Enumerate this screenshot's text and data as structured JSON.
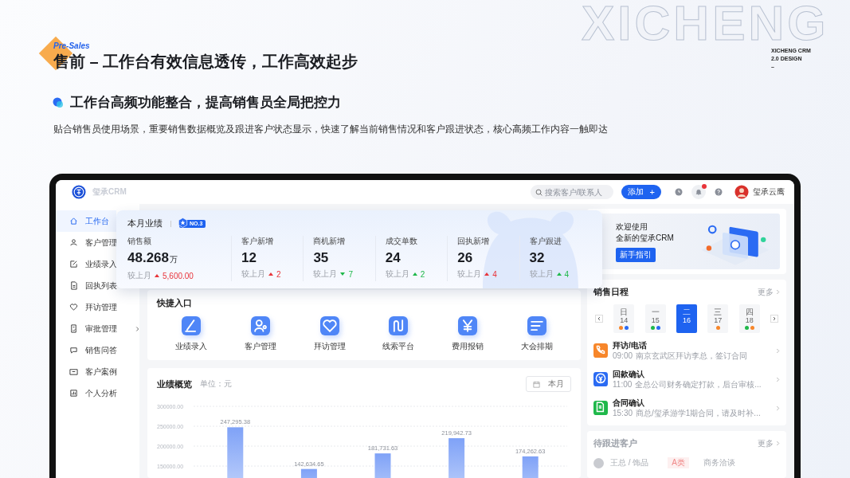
{
  "slide": {
    "tag": "Pre-Sales",
    "title": "售前 – 工作台有效信息透传，工作高效起步",
    "backdrop": "XICHENG",
    "brand_lines": [
      "XICHENG CRM",
      "2.0 DESIGN",
      "–"
    ],
    "heading": "工作台高频功能整合，提高销售员全局把控力",
    "description": "贴合销售员使用场景，重要销售数据概览及跟进客户状态显示，快速了解当前销售情况和客户跟进状态，核心高频工作内容一触即达"
  },
  "app": {
    "logo_text": "玺承CRM",
    "search": {
      "placeholder": "搜索客户/联系人"
    },
    "add_button": "添加",
    "add_icon": "+",
    "unread": true,
    "user_name": "玺承云鹰"
  },
  "sidebar": {
    "items": [
      {
        "label": "工作台",
        "selected": true,
        "expandable": false
      },
      {
        "label": "客户管理",
        "selected": false,
        "expandable": false
      },
      {
        "label": "业绩录入",
        "selected": false,
        "expandable": false
      },
      {
        "label": "回执列表",
        "selected": false,
        "expandable": false
      },
      {
        "label": "拜访管理",
        "selected": false,
        "expandable": false
      },
      {
        "label": "审批管理",
        "selected": false,
        "expandable": true
      },
      {
        "label": "销售问答",
        "selected": false,
        "expandable": false
      },
      {
        "label": "客户案例",
        "selected": false,
        "expandable": false
      },
      {
        "label": "个人分析",
        "selected": false,
        "expandable": false
      }
    ]
  },
  "performance": {
    "title": "本月业绩",
    "rank": "NO.3",
    "stats": [
      {
        "label": "销售额",
        "value": "48.268",
        "unit": "万",
        "compare_label": "较上月",
        "rising": true,
        "change": "5,600.00",
        "color": "#e8343a"
      },
      {
        "label": "客户新增",
        "value": "12",
        "compare_label": "较上月",
        "rising": true,
        "change": "2",
        "color": "#e8343a"
      },
      {
        "label": "商机新增",
        "value": "35",
        "compare_label": "较上月",
        "rising": false,
        "change": "7",
        "color": "#1fb84a"
      },
      {
        "label": "成交单数",
        "value": "24",
        "compare_label": "较上月",
        "rising": true,
        "change": "2",
        "color": "#1fb84a"
      },
      {
        "label": "回执新增",
        "value": "26",
        "compare_label": "较上月",
        "rising": true,
        "change": "4",
        "color": "#e8343a"
      },
      {
        "label": "客户跟进",
        "value": "32",
        "compare_label": "较上月",
        "rising": true,
        "change": "4",
        "color": "#1fb84a"
      }
    ]
  },
  "quick_entry": {
    "title": "快捷入口",
    "items": [
      "业绩录入",
      "客户管理",
      "拜访管理",
      "线索平台",
      "费用报销",
      "大会排期"
    ]
  },
  "overview": {
    "title": "业绩概览",
    "unit_label": "单位：元",
    "period": "本月",
    "chart_data": {
      "type": "bar",
      "values": [
        247295.38,
        142634.65,
        181731.63,
        219942.73,
        174262.63
      ],
      "value_labels": [
        "247,295.38",
        "142,634.65",
        "181,731.63",
        "219,942.73",
        "174,262.63"
      ],
      "ylim": [
        0,
        300000
      ],
      "grid": true,
      "yticks": [
        {
          "value": 300000,
          "label": "300000.00"
        },
        {
          "value": 250000,
          "label": "250000.00"
        },
        {
          "value": 200000,
          "label": "200000.00"
        },
        {
          "value": 150000,
          "label": "150000.00"
        }
      ]
    }
  },
  "welcome": {
    "lines": [
      "欢迎使用",
      "全新的玺承CRM"
    ],
    "button": "新手指引"
  },
  "schedule": {
    "title": "销售日程",
    "more": "更多",
    "days": [
      {
        "weekday": "日",
        "date": "14",
        "selected": false,
        "dots": [
          {
            "color": "#f7862a"
          },
          {
            "color": "#2b6bf3"
          }
        ]
      },
      {
        "weekday": "一",
        "date": "15",
        "selected": false,
        "dots": [
          {
            "color": "#1fb84a"
          },
          {
            "color": "#2b6bf3"
          }
        ]
      },
      {
        "weekday": "二",
        "date": "16",
        "selected": true
      },
      {
        "weekday": "三",
        "date": "17",
        "selected": false,
        "dots": [
          {
            "color": "#f7862a"
          }
        ]
      },
      {
        "weekday": "四",
        "date": "18",
        "selected": false,
        "dots": [
          {
            "color": "#1fb84a"
          },
          {
            "color": "#f7862a"
          }
        ]
      }
    ],
    "events": [
      {
        "title": "拜访/电话",
        "time": "09:00",
        "detail": "南京玄武区拜访李总，签订合同",
        "color": "#f7862a"
      },
      {
        "title": "回款确认",
        "time": "11:00",
        "detail": "全总公司财务确定打款，后台审核...",
        "color": "#2b6bf3"
      },
      {
        "title": "合同确认",
        "time": "15:30",
        "detail": "商总/玺承游学1期合同，请及时补...",
        "color": "#1fb84a"
      }
    ]
  },
  "follow_up": {
    "title": "待跟进客户",
    "more": "更多",
    "customers": [
      {
        "name": "王总 / 饰品",
        "tag": "A类",
        "stage": "商务洽谈"
      }
    ]
  }
}
